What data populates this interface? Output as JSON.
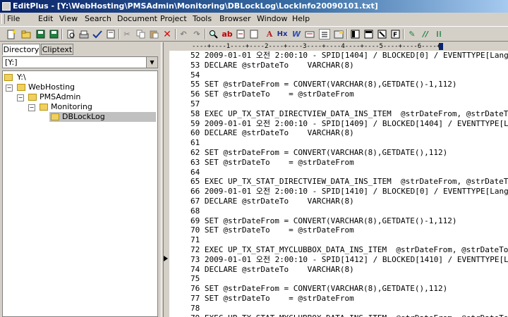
{
  "window": {
    "title": "EditPlus - [Y:\\WebHosting\\PMSAdmin\\Monitoring\\DBLockLog\\LockInfo20090101.txt]"
  },
  "menu": [
    "File",
    "Edit",
    "View",
    "Search",
    "Document",
    "Project",
    "Tools",
    "Browser",
    "Window",
    "Help"
  ],
  "toolbar": {
    "icons": [
      "new-file",
      "open-file",
      "save",
      "save-all",
      "print-preview",
      "print",
      "spell-check",
      "page-setup",
      "cut",
      "copy",
      "paste",
      "delete",
      "undo",
      "redo",
      "find",
      "replace",
      "go-to",
      "font",
      "hex",
      "word-wrap",
      "ruler",
      "line-number",
      "user-tool",
      "browser",
      "clipboard",
      "directory",
      "clip",
      "function-list",
      "cliptext"
    ],
    "font_label": "A",
    "hex_label": "Hx",
    "word_label": "W"
  },
  "left_panel": {
    "tabs": [
      "Directory",
      "Cliptext"
    ],
    "active_tab": "Directory",
    "drive": "[Y:]",
    "tree": [
      {
        "label": "Y:\\",
        "level": 0,
        "expander": "none"
      },
      {
        "label": "WebHosting",
        "level": 1,
        "expander": "-"
      },
      {
        "label": "PMSAdmin",
        "level": 2,
        "expander": "-"
      },
      {
        "label": "Monitoring",
        "level": 3,
        "expander": "-"
      },
      {
        "label": "DBLockLog",
        "level": 4,
        "expander": "none",
        "selected": true
      }
    ]
  },
  "ruler": "----+----1----+----2----+----3----+----4----+----5----+----6----+",
  "editor": {
    "current_line": 73,
    "lines": [
      {
        "n": "52",
        "text": "2009-01-01 오전 2:00:10 - SPID[1404] / BLOCKED[0] / EVENTTYPE[Lang"
      },
      {
        "n": "53",
        "text": "DECLARE @strDateTo    VARCHAR(8)"
      },
      {
        "n": "54",
        "text": ""
      },
      {
        "n": "55",
        "text": "SET @strDateFrom = CONVERT(VARCHAR(8),GETDATE()-1,112)"
      },
      {
        "n": "56",
        "text": "SET @strDateTo    = @strDateFrom"
      },
      {
        "n": "57",
        "text": ""
      },
      {
        "n": "58",
        "text": "EXEC UP_TX_STAT_DIRECTVIEW_DATA_INS_ITEM  @strDateFrom, @strDateTo"
      },
      {
        "n": "59",
        "text": "2009-01-01 오전 2:00:10 - SPID[1409] / BLOCKED[1404] / EVENTTYPE[L"
      },
      {
        "n": "60",
        "text": "DECLARE @strDateTo    VARCHAR(8)"
      },
      {
        "n": "61",
        "text": ""
      },
      {
        "n": "62",
        "text": "SET @strDateFrom = CONVERT(VARCHAR(8),GETDATE(),112)"
      },
      {
        "n": "63",
        "text": "SET @strDateTo    = @strDateFrom"
      },
      {
        "n": "64",
        "text": ""
      },
      {
        "n": "65",
        "text": "EXEC UP_TX_STAT_DIRECTVIEW_DATA_INS_ITEM  @strDateFrom, @strDateTo"
      },
      {
        "n": "66",
        "text": "2009-01-01 오전 2:00:10 - SPID[1410] / BLOCKED[0] / EVENTTYPE[Lang"
      },
      {
        "n": "67",
        "text": "DECLARE @strDateTo    VARCHAR(8)"
      },
      {
        "n": "68",
        "text": ""
      },
      {
        "n": "69",
        "text": "SET @strDateFrom = CONVERT(VARCHAR(8),GETDATE()-1,112)"
      },
      {
        "n": "70",
        "text": "SET @strDateTo    = @strDateFrom"
      },
      {
        "n": "71",
        "text": ""
      },
      {
        "n": "72",
        "text": "EXEC UP_TX_STAT_MYCLUBBOX_DATA_INS_ITEM  @strDateFrom, @strDateTo"
      },
      {
        "n": "73",
        "text": "2009-01-01 오전 2:00:10 - SPID[1412] / BLOCKED[1410] / EVENTTYPE[L"
      },
      {
        "n": "74",
        "text": "DECLARE @strDateTo    VARCHAR(8)"
      },
      {
        "n": "75",
        "text": ""
      },
      {
        "n": "76",
        "text": "SET @strDateFrom = CONVERT(VARCHAR(8),GETDATE(),112)"
      },
      {
        "n": "77",
        "text": "SET @strDateTo    = @strDateFrom"
      },
      {
        "n": "78",
        "text": ""
      },
      {
        "n": "79",
        "text": "EXEC UP_TX_STAT_MYCLUBBOX_DATA_INS_ITEM  @strDateFrom, @strDateTo"
      }
    ]
  }
}
